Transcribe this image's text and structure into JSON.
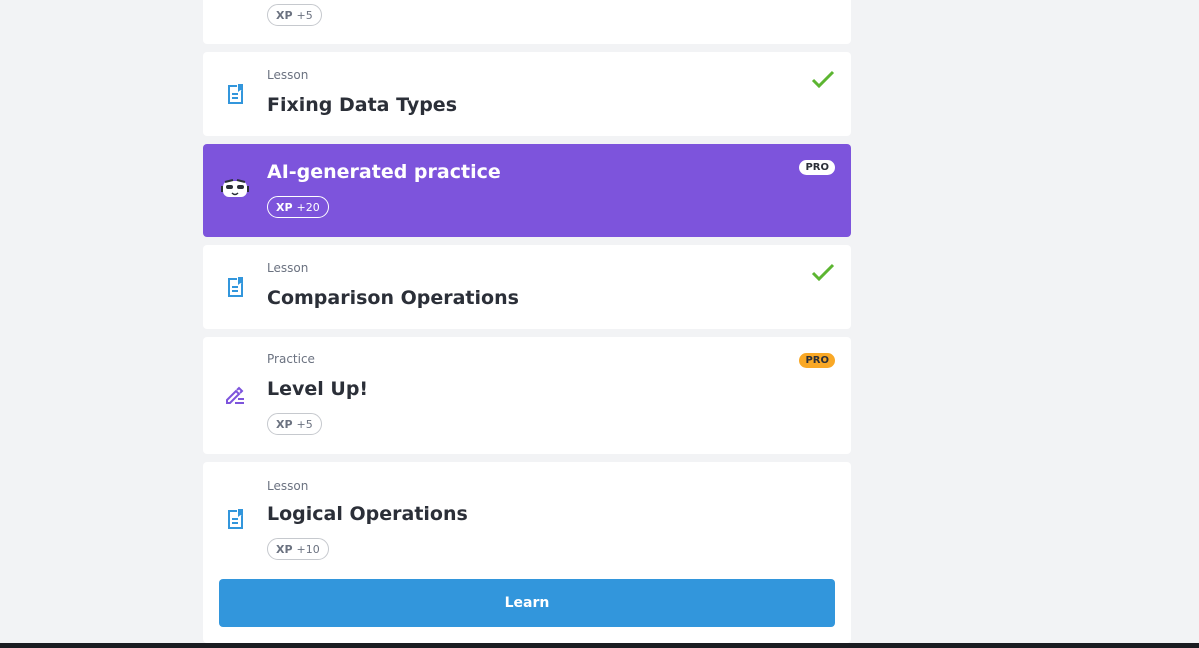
{
  "items": [
    {
      "type": "",
      "title": "",
      "xp_label": "XP",
      "xp_value": "+5"
    },
    {
      "type": "Lesson",
      "title": "Fixing Data Types",
      "completed": true
    },
    {
      "type": "",
      "title": "AI-generated practice",
      "badge": "PRO",
      "xp_label": "XP",
      "xp_value": "+20"
    },
    {
      "type": "Lesson",
      "title": "Comparison Operations",
      "completed": true
    },
    {
      "type": "Practice",
      "title": "Level Up!",
      "badge": "PRO",
      "xp_label": "XP",
      "xp_value": "+5"
    },
    {
      "type": "Lesson",
      "title": "Logical Operations",
      "xp_label": "XP",
      "xp_value": "+10"
    }
  ],
  "learn_button": {
    "label": "Learn"
  },
  "colors": {
    "accent_purple": "#7d54dc",
    "button_blue": "#3296dc",
    "check_green": "#5cb531",
    "pro_orange": "#f9a826",
    "lesson_icon_blue": "#3296dc"
  }
}
